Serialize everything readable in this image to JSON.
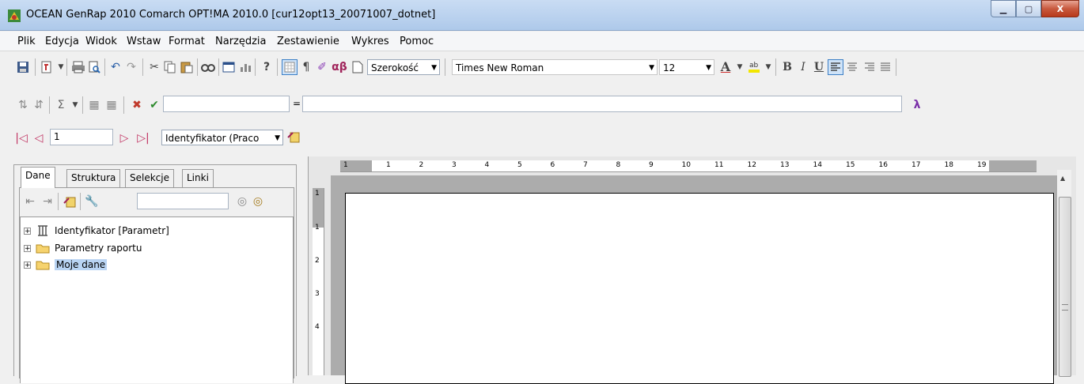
{
  "window": {
    "title": "OCEAN GenRap 2010 Comarch OPT!MA 2010.0  [cur12opt13_20071007_dotnet]",
    "minimize": "▁",
    "maximize": "▢",
    "close": "X"
  },
  "menu": [
    "Plik",
    "Edycja",
    "Widok",
    "Wstaw",
    "Format",
    "Narzędzia",
    "Zestawienie",
    "Wykres",
    "Pomoc"
  ],
  "toolbar1": {
    "width_combo": "Szerokość",
    "font_combo": "Times New Roman",
    "size_combo": "12",
    "alpha_beta": "αβ",
    "bold": "B",
    "italic": "I",
    "underline": "U"
  },
  "toolbar2": {
    "equals": "=",
    "lambda": "λ",
    "cell_ref_value": "",
    "formula_value": ""
  },
  "toolbar3": {
    "record_number": "1",
    "field_combo": "Identyfikator (Praco"
  },
  "left_panel": {
    "tabs": [
      "Dane",
      "Struktura",
      "Selekcje",
      "Linki"
    ],
    "active_tab": "Dane",
    "search_value": "",
    "tree": [
      {
        "label": "Identyfikator [Parametr]",
        "icon": "parameter-icon"
      },
      {
        "label": "Parametry raportu",
        "icon": "folder-icon"
      },
      {
        "label": "Moje dane",
        "icon": "folder-icon",
        "selected": true
      }
    ]
  },
  "ruler": {
    "horizontal": [
      "1",
      "1",
      "2",
      "3",
      "4",
      "5",
      "6",
      "7",
      "8",
      "9",
      "10",
      "11",
      "12",
      "13",
      "14",
      "15",
      "16",
      "17",
      "18",
      "19"
    ],
    "vertical": [
      "1",
      "1",
      "2",
      "3",
      "4"
    ]
  },
  "colors": {
    "title_gradient": "#b9d1ee",
    "close_button": "#c85a3f",
    "selection": "#b9d4f3",
    "ruler_highlight": "#a9a9a9"
  }
}
